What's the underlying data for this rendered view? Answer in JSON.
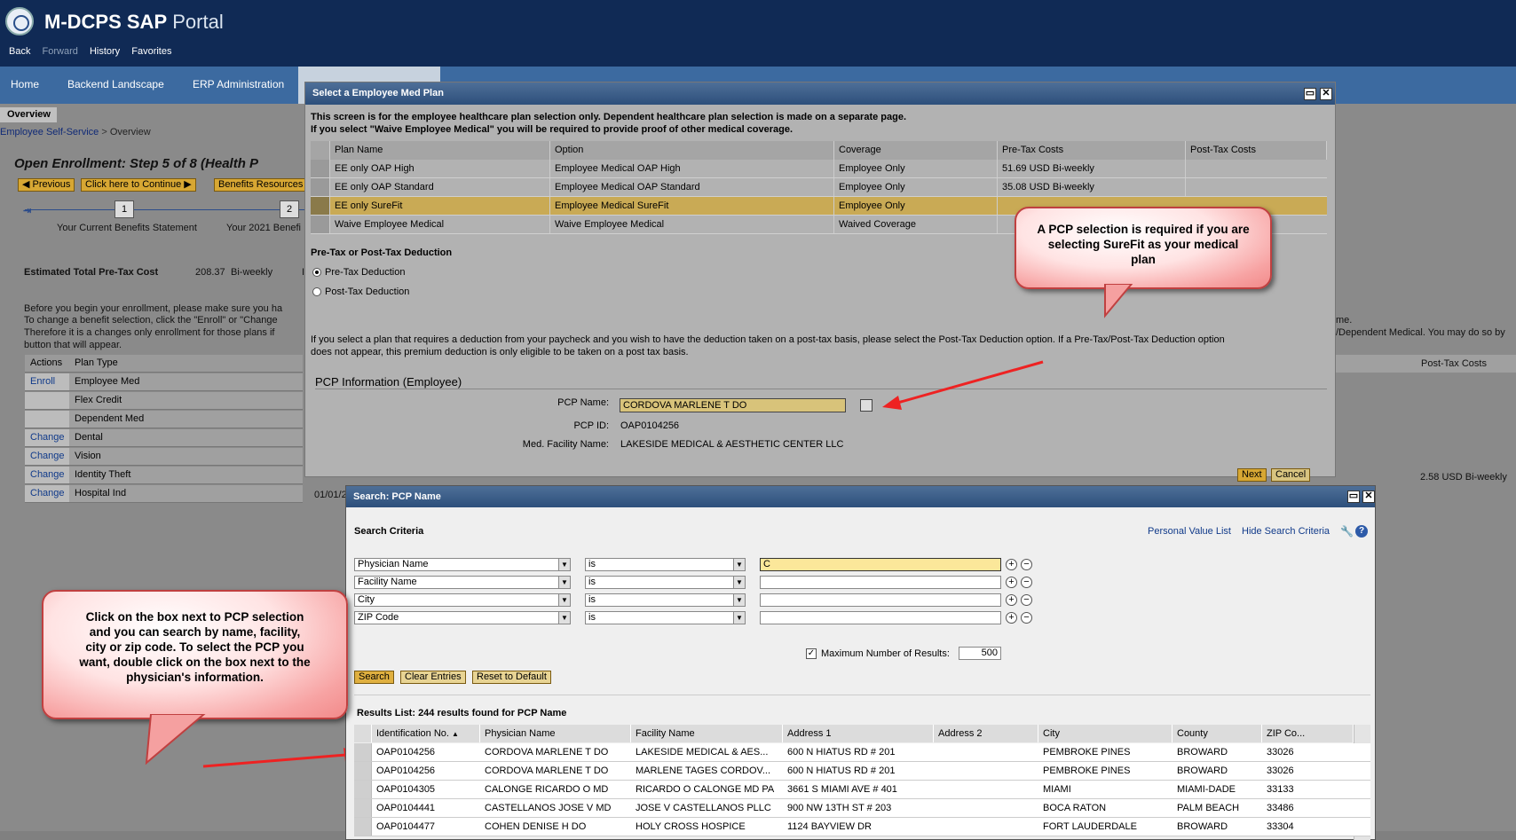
{
  "header": {
    "app_title_bold": "M-DCPS SAP",
    "app_title_rest": "Portal",
    "nav": [
      "Back",
      "Forward",
      "History",
      "Favorites"
    ]
  },
  "top_nav": [
    "Home",
    "Backend Landscape",
    "ERP Administration"
  ],
  "sub_tab": "Overview",
  "breadcrumb": {
    "root": "Employee Self-Service",
    "sep": ">",
    "current": "Overview"
  },
  "page_title": "Open Enrollment: Step 5  of 8  (Health P",
  "buttons": {
    "previous": "Previous",
    "continue": "Click here to Continue",
    "resources": "Benefits Resources"
  },
  "steps": {
    "step1": "1",
    "step2": "2",
    "step1_label": "Your Current Benefits Statement",
    "step2_label": "Your 2021 Benefi"
  },
  "estimate": {
    "label": "Estimated Total Pre-Tax Cost",
    "value": "208.37",
    "period": "Bi-weekly",
    "extra": "I"
  },
  "intro_lines": [
    "Before you begin your enrollment, please make sure you ha",
    "To change a benefit selection, click the \"Enroll\" or \"Change",
    "Therefore it is a changes only enrollment for those plans if",
    "button that will appear."
  ],
  "right_text": {
    "line1": "me.",
    "line2": "/Dependent Medical. You may do so by",
    "col_header": "Post-Tax Costs",
    "row_value": "2.58 USD Bi-weekly"
  },
  "bg_table": {
    "headers": [
      "Actions",
      "Plan Type"
    ],
    "rows": [
      {
        "action": "Enroll",
        "type": "Employee Med"
      },
      {
        "action": "",
        "type": "Flex Credit"
      },
      {
        "action": "",
        "type": "Dependent Med"
      },
      {
        "action": "Change",
        "type": "Dental"
      },
      {
        "action": "Change",
        "type": "Vision"
      },
      {
        "action": "Change",
        "type": "Identity Theft"
      },
      {
        "action": "Change",
        "type": "Hospital Ind"
      }
    ],
    "date_frag": "01/01/2"
  },
  "med_dialog": {
    "title": "Select a Employee Med Plan",
    "info1": "This screen is for the employee healthcare plan selection only. Dependent healthcare plan selection is made on a separate page.",
    "info2": "If you select \"Waive Employee Medical\" you will be required to provide proof of other medical coverage.",
    "headers": [
      "Plan Name",
      "Option",
      "Coverage",
      "Pre-Tax Costs",
      "Post-Tax Costs"
    ],
    "rows": [
      {
        "plan": "EE only OAP High",
        "option": "Employee Medical OAP High",
        "coverage": "Employee Only",
        "pretax": "51.69 USD Bi-weekly",
        "posttax": ""
      },
      {
        "plan": "EE only OAP Standard",
        "option": "Employee Medical OAP Standard",
        "coverage": "Employee Only",
        "pretax": "35.08 USD Bi-weekly",
        "posttax": ""
      },
      {
        "plan": "EE only SureFit",
        "option": "Employee Medical SureFit",
        "coverage": "Employee Only",
        "pretax": "",
        "posttax": ""
      },
      {
        "plan": "Waive Employee Medical",
        "option": "Waive Employee Medical",
        "coverage": "Waived Coverage",
        "pretax": "",
        "posttax": ""
      }
    ],
    "deduction_title": "Pre-Tax or Post-Tax Deduction",
    "pretax_label": "Pre-Tax Deduction",
    "posttax_label": "Post-Tax Deduction",
    "deduction_info1": "If you select a plan that requires a deduction from your paycheck and you wish to have the deduction taken on a post-tax basis, please select the Post-Tax Deduction option. If a Pre-Tax/Post-Tax Deduction option",
    "deduction_info2": "does not appear, this premium deduction is only eligible to be taken on a post tax basis.",
    "pcp_section": "PCP Information (Employee)",
    "pcp_name_label": "PCP Name:",
    "pcp_name_value": "CORDOVA MARLENE T   DO",
    "pcp_id_label": "PCP ID:",
    "pcp_id_value": "OAP0104256",
    "facility_label": "Med. Facility Name:",
    "facility_value": "LAKESIDE MEDICAL & AESTHETIC CENTER LLC",
    "next": "Next",
    "cancel": "Cancel"
  },
  "callout1": {
    "text": "A PCP selection is required if you are selecting SureFit as your medical plan"
  },
  "callout2": {
    "text": "Click on the box next to PCP selection and you can search by name, facility, city or zip code.  To select the PCP you want, double click on the box next to the physician's information."
  },
  "search_dialog": {
    "title": "Search: PCP Name",
    "criteria_label": "Search Criteria",
    "personal_value_list": "Personal Value List",
    "hide_criteria": "Hide Search Criteria",
    "criteria": [
      {
        "field": "Physician Name",
        "op": "is",
        "value": "C"
      },
      {
        "field": "Facility Name",
        "op": "is",
        "value": ""
      },
      {
        "field": "City",
        "op": "is",
        "value": ""
      },
      {
        "field": "ZIP Code",
        "op": "is",
        "value": ""
      }
    ],
    "max_results_label": "Maximum Number of Results:",
    "max_results_value": "500",
    "search_btn": "Search",
    "clear_btn": "Clear Entries",
    "reset_btn": "Reset to Default",
    "results_title": "Results List: 244 results found for PCP Name",
    "headers": [
      "Identification No.",
      "Physician Name",
      "Facility Name",
      "Address 1",
      "Address 2",
      "City",
      "County",
      "ZIP Co..."
    ],
    "rows": [
      {
        "id": "OAP0104256",
        "name": "CORDOVA MARLENE T   DO",
        "facility": "LAKESIDE MEDICAL & AES...",
        "addr1": "600 N HIATUS RD # 201",
        "addr2": "",
        "city": "PEMBROKE PINES",
        "county": "BROWARD",
        "zip": "33026"
      },
      {
        "id": "OAP0104256",
        "name": "CORDOVA MARLENE T   DO",
        "facility": "MARLENE TAGES CORDOV...",
        "addr1": "600 N HIATUS RD # 201",
        "addr2": "",
        "city": "PEMBROKE PINES",
        "county": "BROWARD",
        "zip": "33026"
      },
      {
        "id": "OAP0104305",
        "name": "CALONGE RICARDO O   MD",
        "facility": "RICARDO O CALONGE MD PA",
        "addr1": "3661 S MIAMI AVE # 401",
        "addr2": "",
        "city": "MIAMI",
        "county": "MIAMI-DADE",
        "zip": "33133"
      },
      {
        "id": "OAP0104441",
        "name": "CASTELLANOS JOSE V   MD",
        "facility": "JOSE V CASTELLANOS PLLC",
        "addr1": "900 NW 13TH ST # 203",
        "addr2": "",
        "city": "BOCA RATON",
        "county": "PALM BEACH",
        "zip": "33486"
      },
      {
        "id": "OAP0104477",
        "name": "COHEN DENISE H   DO",
        "facility": "HOLY CROSS HOSPICE",
        "addr1": "1124 BAYVIEW DR",
        "addr2": "",
        "city": "FORT LAUDERDALE",
        "county": "BROWARD",
        "zip": "33304"
      }
    ]
  }
}
